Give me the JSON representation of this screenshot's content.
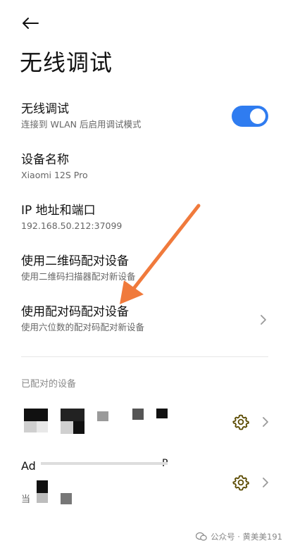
{
  "page": {
    "title": "无线调试"
  },
  "wireless_debug": {
    "title": "无线调试",
    "subtitle": "连接到 WLAN 后启用调试模式",
    "enabled": true
  },
  "device_name": {
    "title": "设备名称",
    "value": "Xiaomi 12S Pro"
  },
  "ip_port": {
    "title": "IP 地址和端口",
    "value": "192.168.50.212:37099"
  },
  "qr_pair": {
    "title": "使用二维码配对设备",
    "subtitle": "使用二维码扫描器配对新设备"
  },
  "code_pair": {
    "title": "使用配对码配对设备",
    "subtitle": "使用六位数的配对码配对新设备"
  },
  "paired_section": {
    "label": "已配对的设备"
  },
  "paired_devices": [
    {
      "label_fragment": ""
    },
    {
      "label_fragment_start": "Ad",
      "label_fragment_end": "P",
      "sub_fragment": "当"
    }
  ],
  "watermark": {
    "text": "公众号 · 黄美美191"
  },
  "colors": {
    "accent": "#2f7cf0",
    "arrow": "#f07a3c",
    "gear": "#5a4a00"
  }
}
